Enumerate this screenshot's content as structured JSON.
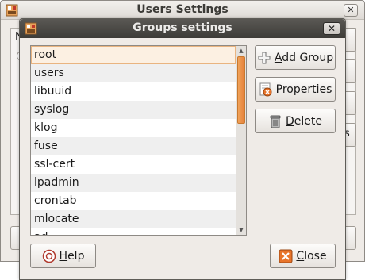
{
  "background_window": {
    "title": "Users Settings",
    "close_glyph": "✕",
    "panel_label": "N",
    "partial_button_text": "s"
  },
  "dialog": {
    "title": "Groups settings",
    "close_glyph": "✕"
  },
  "groups": [
    "root",
    "users",
    "libuuid",
    "syslog",
    "klog",
    "fuse",
    "ssl-cert",
    "lpadmin",
    "crontab",
    "mlocate",
    "ad"
  ],
  "selected_group": "root",
  "buttons": {
    "add_group_accel": "A",
    "add_group_rest": "dd Group",
    "properties_accel": "P",
    "properties_rest": "roperties",
    "delete_accel": "D",
    "delete_rest": "elete",
    "help_accel": "H",
    "help_rest": "elp",
    "close_accel": "C",
    "close_rest": "lose"
  },
  "colors": {
    "accent_orange": "#e9803a",
    "titlebar_dark": "#3d3c38",
    "window_bg": "#efebe7"
  }
}
